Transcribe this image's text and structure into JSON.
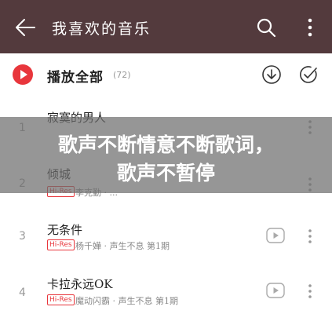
{
  "header": {
    "title": "我喜欢的音乐",
    "icons": [
      "back-icon",
      "search-icon",
      "more-vertical-icon"
    ],
    "background": "#533a3d"
  },
  "play_all": {
    "label": "播放全部",
    "count": "(72)",
    "accent": "#e8363c"
  },
  "songs": [
    {
      "index": "1",
      "title": "寂寞的男人",
      "badge": "",
      "subtitle": ""
    },
    {
      "index": "2",
      "title": "倾城",
      "badge": "Hi-Res",
      "subtitle": "李克勤 · ..."
    },
    {
      "index": "3",
      "title": "无条件",
      "badge": "Hi-Res",
      "subtitle": "杨千嬅 · 声生不息 第1期"
    },
    {
      "index": "4",
      "title": "卡拉永远OK",
      "badge": "Hi-Res",
      "subtitle": "魔动闪霸 · 声生不息 第1期"
    }
  ],
  "overlay": {
    "line1": "歌声不断情意不断歌词，",
    "line2": "歌声不暂停"
  }
}
